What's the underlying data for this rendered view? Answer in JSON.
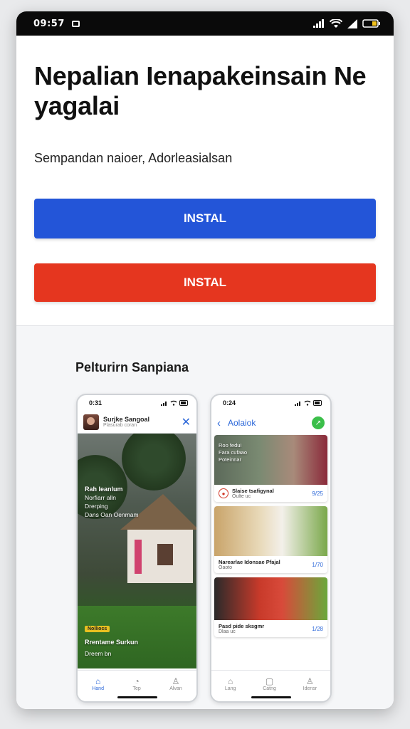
{
  "status_bar": {
    "time": "09:57"
  },
  "header": {
    "title": "Nepalian Ienapakeinsain Ne yagalai",
    "subtitle": "Sempandan naioer, Adorleasialsan"
  },
  "buttons": {
    "install_primary": "INSTAL",
    "install_secondary": "INSTAL"
  },
  "colors": {
    "primary_blue": "#2355d8",
    "install_red": "#e5361f",
    "accent_blue": "#2b67d9"
  },
  "screenshots": {
    "section_title": "Pelturirn Sanpiana",
    "phone1": {
      "time": "0:31",
      "profile_name": "Surjke Sangoal",
      "profile_sub": "Plasurab coran",
      "hero_heading": "Rah Ieanlum",
      "hero_line1": "Norfiarr alln",
      "hero_line2": "Drerping",
      "hero_line3": "Dans Oan Oenmam",
      "tag": "Nolliocs",
      "hero_footer_title": "Rrentame Surkun",
      "hero_footer_sub": "Dreem bn",
      "tabs": [
        "Hand",
        "Tep",
        "Alvan"
      ]
    },
    "phone2": {
      "time": "0:24",
      "header_title": "Aolaiok",
      "cards": [
        {
          "overlay1": "Roo fedui",
          "overlay2": "Fara cufaao",
          "overlay3": "Poteinnar",
          "name": "Slaise tsafigynal",
          "sub": "Oulte uc",
          "price": "9/25"
        },
        {
          "name": "Narearlae Idonsae Pfajal",
          "sub": "Oaoto",
          "price": "1/70"
        },
        {
          "name": "Pasd pide sksgmr",
          "sub": "Dlaa uc",
          "price": "1/28"
        }
      ],
      "tabs": [
        "Lang",
        "Catng",
        "Idensr"
      ]
    }
  }
}
